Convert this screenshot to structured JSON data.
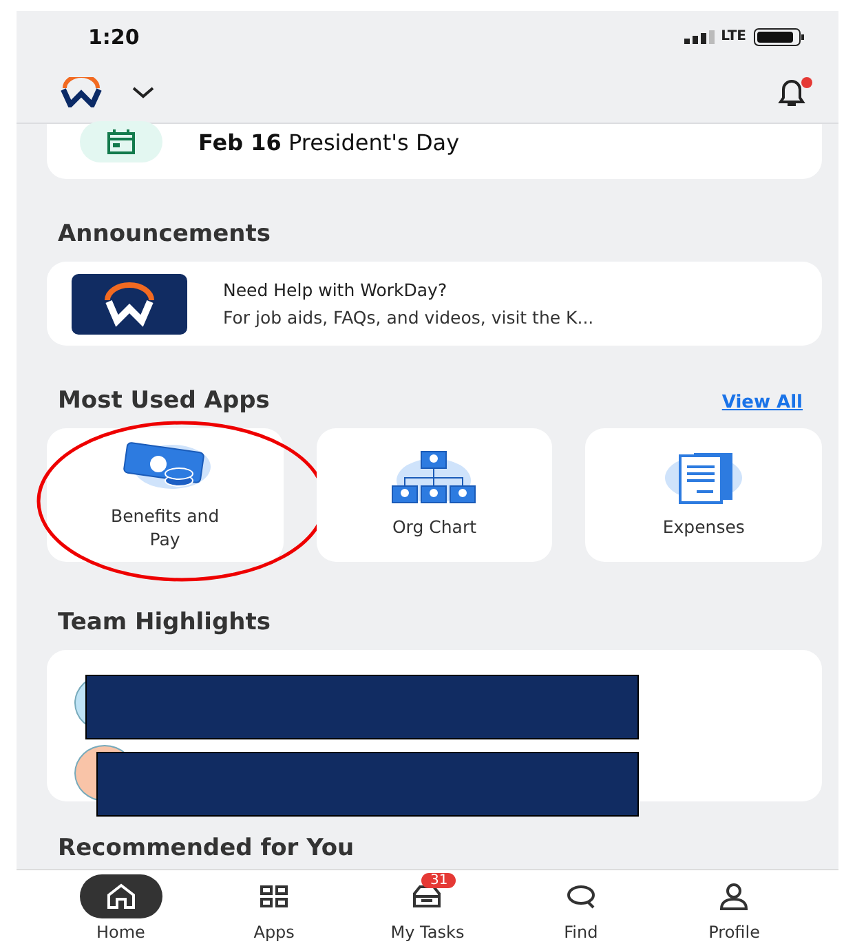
{
  "status_bar": {
    "time": "1:20",
    "network": "LTE"
  },
  "header": {
    "notification_unread": true
  },
  "holiday": {
    "date": "Feb 16",
    "name": "President's Day"
  },
  "announcements": {
    "title": "Announcements",
    "items": [
      {
        "title": "Need Help with WorkDay?",
        "text": "For job aids, FAQs, and videos, visit the K..."
      }
    ]
  },
  "most_used_apps": {
    "title": "Most Used Apps",
    "link": "View All",
    "apps": [
      {
        "kind": "benefits",
        "label": "Benefits and Pay",
        "highlighted": true
      },
      {
        "kind": "orgchart",
        "label": "Org Chart",
        "highlighted": false
      },
      {
        "kind": "expenses",
        "label": "Expenses",
        "highlighted": false
      }
    ]
  },
  "team_highlights": {
    "title": "Team Highlights",
    "rows": [
      {
        "color": "#bfe3f5"
      },
      {
        "color": "#f9c4a8"
      }
    ]
  },
  "recommended": {
    "title": "Recommended for You"
  },
  "nav": [
    {
      "kind": "home",
      "label": "Home",
      "selected": true
    },
    {
      "kind": "apps",
      "label": "Apps",
      "selected": false
    },
    {
      "kind": "tasks",
      "label": "My Tasks",
      "selected": false,
      "badge": "31"
    },
    {
      "kind": "find",
      "label": "Find",
      "selected": false
    },
    {
      "kind": "profile",
      "label": "Profile",
      "selected": false
    }
  ]
}
